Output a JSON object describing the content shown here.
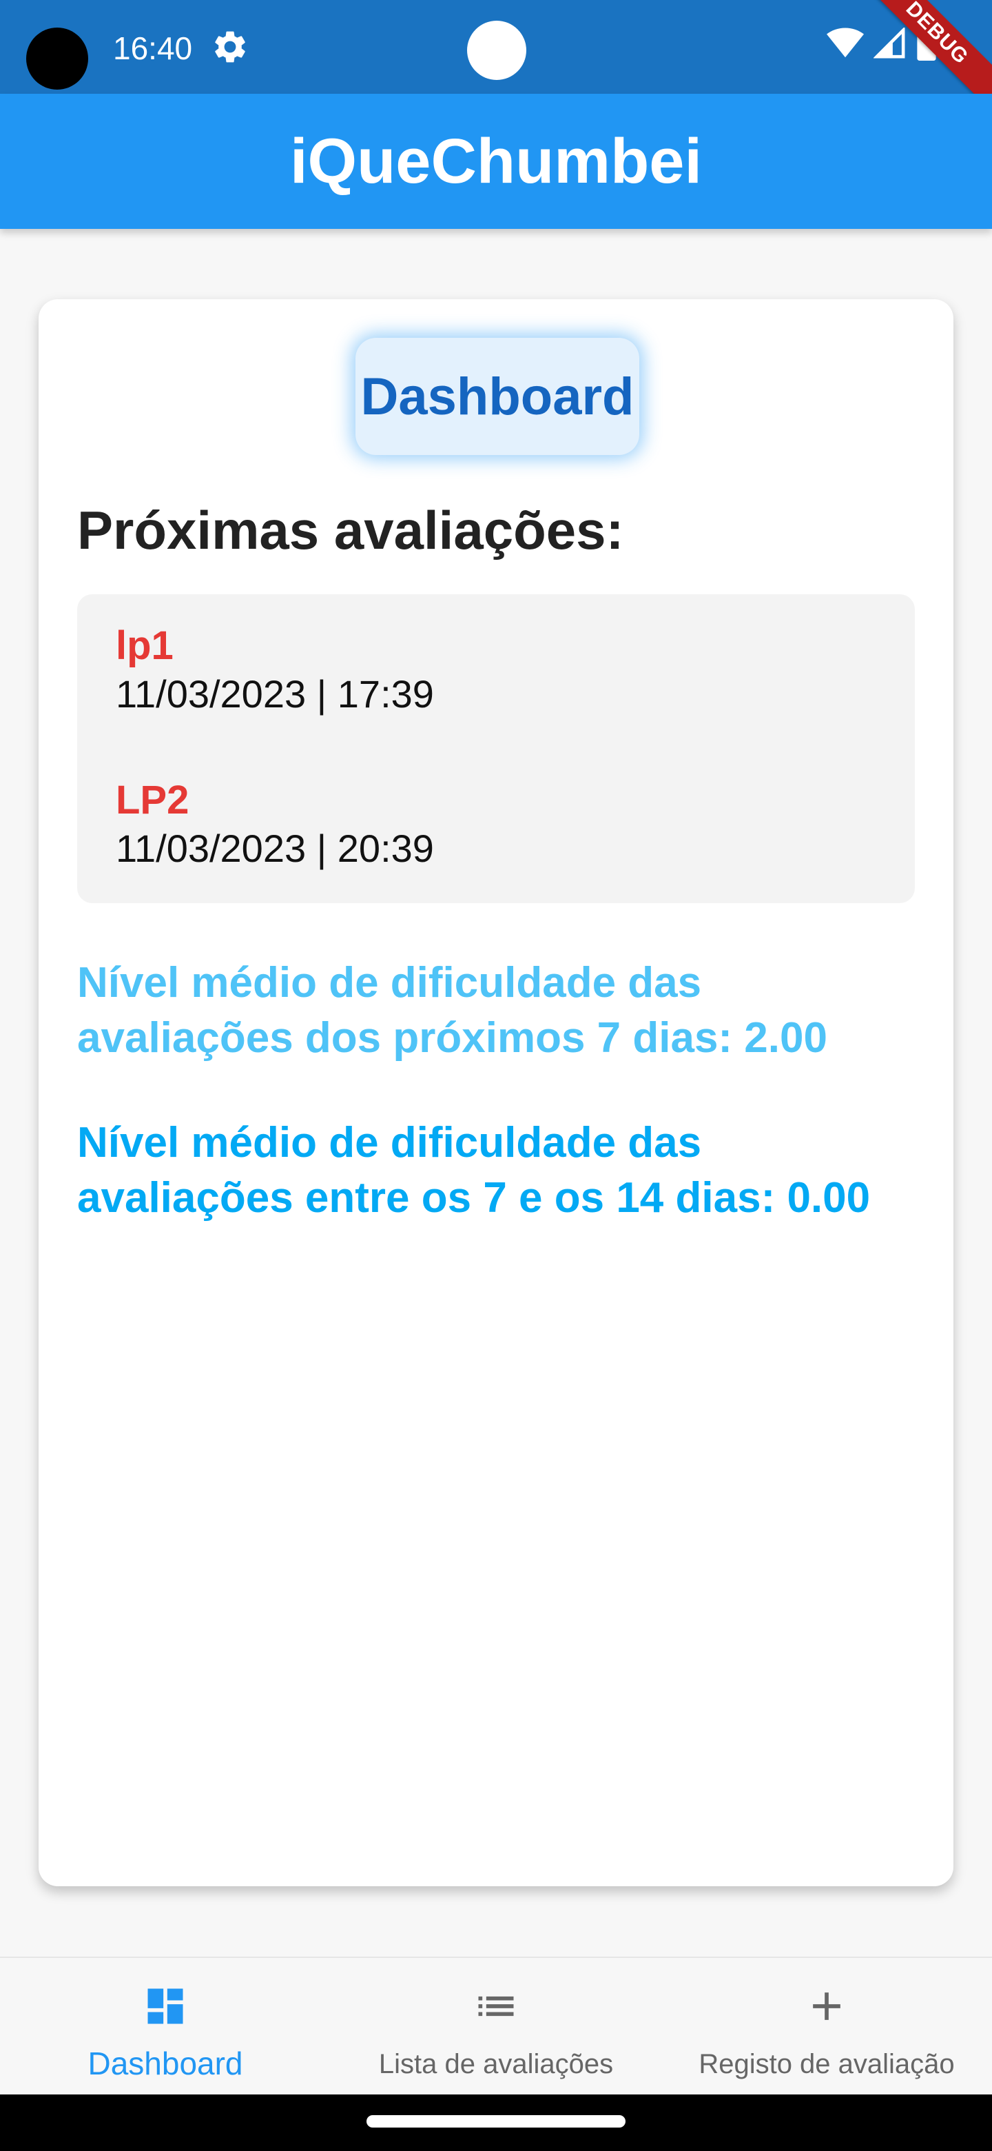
{
  "status_bar": {
    "time": "16:40",
    "icons": [
      "settings-icon",
      "wifi-icon",
      "signal-icon",
      "battery-icon"
    ],
    "debug_banner": "DEBUG"
  },
  "app_bar": {
    "title": "iQueChumbei"
  },
  "card": {
    "dashboard_button": "Dashboard",
    "section_title": "Próximas avaliações:",
    "upcoming": [
      {
        "name": "lp1",
        "datetime": "11/03/2023 | 17:39"
      },
      {
        "name": "LP2",
        "datetime": "11/03/2023 | 20:39"
      }
    ],
    "stats": {
      "next_7_days": "Nível médio de dificuldade das avaliações dos próximos 7 dias: 2.00",
      "between_7_and_14_days": "Nível médio de dificuldade das avaliações entre os 7 e os 14 dias: 0.00"
    }
  },
  "bottom_nav": {
    "items": [
      {
        "label": "Dashboard",
        "icon": "dashboard-icon",
        "selected": true
      },
      {
        "label": "Lista de avaliações",
        "icon": "list-icon",
        "selected": false
      },
      {
        "label": "Registo de avaliação",
        "icon": "add-icon",
        "selected": false
      }
    ]
  },
  "colors": {
    "status_bar": "#1a73c1",
    "app_bar": "#2196f3",
    "accent": "#2196f3",
    "item_name": "#e53935",
    "stat_light": "#4fc3f7",
    "stat_blue": "#03a9f4"
  }
}
